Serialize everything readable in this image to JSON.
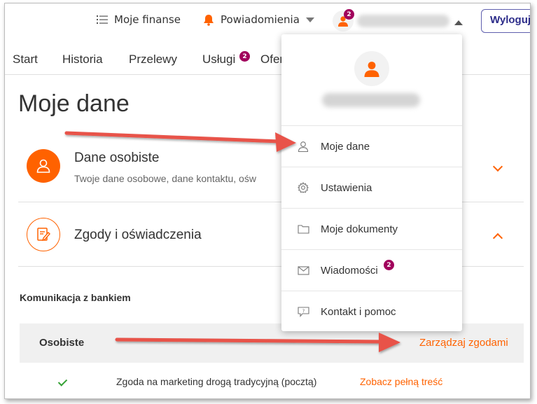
{
  "topbar": {
    "finance_label": "Moje finanse",
    "notifications_label": "Powiadomienia",
    "user_badge": "2",
    "logout_label": "Wyloguj"
  },
  "nav": {
    "items": [
      {
        "label": "Start"
      },
      {
        "label": "Historia"
      },
      {
        "label": "Przelewy"
      },
      {
        "label": "Usługi",
        "badge": "2"
      },
      {
        "label": "Ofer"
      }
    ]
  },
  "main": {
    "title": "Moje dane",
    "sections": [
      {
        "title": "Dane osobiste",
        "subtitle": "Twoje dane osobowe, dane kontaktu, ośw",
        "expanded": false
      },
      {
        "title": "Zgody i oświadczenia",
        "expanded": true
      }
    ],
    "communication_heading": "Komunikacja z bankiem",
    "consent_group_label": "Osobiste",
    "manage_consents_label": "Zarządzaj zgodami",
    "consents": [
      {
        "text": "Zgoda na marketing drogą tradycyjną (pocztą)",
        "link": "Zobacz pełną treść",
        "accepted": true
      }
    ]
  },
  "dropdown": {
    "items": [
      {
        "label": "Moje dane",
        "icon": "user-icon"
      },
      {
        "label": "Ustawienia",
        "icon": "gear-icon"
      },
      {
        "label": "Moje dokumenty",
        "icon": "folder-icon"
      },
      {
        "label": "Wiadomości",
        "icon": "envelope-icon",
        "badge": "2"
      },
      {
        "label": "Kontakt i pomoc",
        "icon": "chat-help-icon"
      }
    ]
  },
  "colors": {
    "accent": "#ff6200",
    "badge": "#a1005c",
    "logout_border": "#5f5fae",
    "annotation_arrow": "#e8534a",
    "check": "#36a236"
  }
}
